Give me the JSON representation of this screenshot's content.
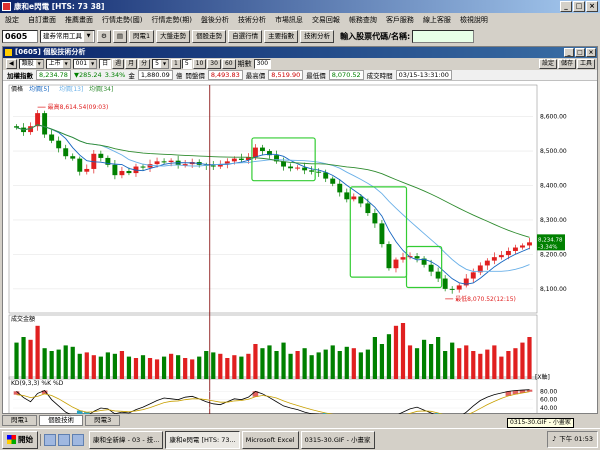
{
  "window": {
    "title": "康和e閃電 [HTS: 73 38]"
  },
  "menu": [
    "設定",
    "自訂畫面",
    "推薦畫面",
    "行情走勢(國)",
    "行情走勢(期)",
    "盤後分析",
    "技術分析",
    "市場訊息",
    "交易回報",
    "帳務查詢",
    "客戶服務",
    "線上客服",
    "檢視說明"
  ],
  "toolbar": {
    "code": "0605",
    "tool_select": "建券常用工具",
    "buttons": [
      "閃電1",
      "大盤走勢",
      "個股走勢",
      "自選行情",
      "主要指數",
      "技術分析"
    ],
    "stock_prompt": "輸入股票代碼/名稱:"
  },
  "child": {
    "title": "[0605] 個股技術分析",
    "win_buttons": [
      "_",
      "□",
      "×"
    ]
  },
  "controls": {
    "category": "類股",
    "market": "上市",
    "index_code": "001",
    "periods": [
      "日",
      "週",
      "月",
      "分"
    ],
    "minute": "5",
    "intervals": [
      "1",
      "5",
      "10",
      "30",
      "60"
    ],
    "active_interval": "5",
    "bars_label": "期數",
    "bars_value": "300",
    "right_buttons": [
      "設定",
      "儲存",
      "工具"
    ]
  },
  "quote": {
    "name": "加權指數",
    "price": "8,234.78",
    "change": "▼285.24",
    "pct": "3.34%",
    "vol_label": "金",
    "volume": "1,880.09",
    "vol_unit": "億",
    "open_label": "開盤價",
    "open": "8,493.83",
    "high_label": "最高價",
    "high": "8,519.90",
    "low_label": "最低價",
    "low": "8,070.52",
    "time_label": "成交時間",
    "time": "03/15-13:31:00"
  },
  "colors": {
    "up": "#e02020",
    "down": "#008000",
    "ma5": "#1565c0",
    "ma13": "#6ab0e8",
    "ma34": "#2e8b2e",
    "highlight_box": "#33cc33",
    "cursor": "#800000",
    "k": "#000000",
    "d": "#c8a000"
  },
  "chart_data": [
    {
      "type": "candlestick",
      "title": "價格",
      "legend": [
        "均價[5]",
        "均價[13]",
        "均價[34]"
      ],
      "ylim": [
        8030,
        8680
      ],
      "yticks": [
        8100,
        8200,
        8300,
        8400,
        8500,
        8600
      ],
      "ytick_labels": [
        "8,100.00",
        "8,200.00",
        "8,300.00",
        "8,400.00",
        "8,500.00",
        "8,600.00"
      ],
      "x_labels": [
        "12:50",
        "03/14",
        "10",
        "11",
        "12",
        "13",
        "03/15",
        "10",
        "11",
        "12",
        "13",
        "13:30"
      ],
      "annotations": [
        {
          "text": "最高8,614.54(09:03)",
          "index": 3
        },
        {
          "text": "最低8,070.52(12:15)",
          "index": 61
        }
      ],
      "last_price_labels": [
        "8,234.78",
        "-3.34%"
      ],
      "closes": [
        8568,
        8555,
        8572,
        8610,
        8548,
        8530,
        8508,
        8485,
        8478,
        8440,
        8448,
        8492,
        8480,
        8460,
        8430,
        8442,
        8436,
        8455,
        8452,
        8462,
        8470,
        8468,
        8472,
        8458,
        8462,
        8468,
        8460,
        8458,
        8455,
        8462,
        8470,
        8478,
        8474,
        8482,
        8510,
        8500,
        8488,
        8470,
        8455,
        8450,
        8452,
        8444,
        8440,
        8438,
        8420,
        8405,
        8380,
        8360,
        8368,
        8348,
        8320,
        8290,
        8230,
        8160,
        8185,
        8192,
        8195,
        8188,
        8170,
        8150,
        8130,
        8100,
        8098,
        8110,
        8130,
        8148,
        8168,
        8182,
        8192,
        8198,
        8210,
        8220,
        8226,
        8235
      ],
      "highlight_boxes": [
        [
          34,
          42
        ],
        [
          48,
          55
        ],
        [
          56,
          60
        ]
      ]
    },
    {
      "type": "bar",
      "title": "成交金額",
      "x_label_button": "[X軸]",
      "values": [
        26,
        30,
        28,
        38,
        22,
        20,
        21,
        24,
        23,
        18,
        19,
        17,
        16,
        19,
        18,
        20,
        16,
        15,
        17,
        15,
        14,
        16,
        18,
        17,
        15,
        14,
        16,
        20,
        19,
        18,
        15,
        17,
        16,
        18,
        25,
        22,
        24,
        20,
        26,
        18,
        20,
        22,
        17,
        19,
        21,
        24,
        20,
        23,
        22,
        19,
        21,
        30,
        25,
        32,
        38,
        40,
        24,
        22,
        28,
        25,
        30,
        20,
        26,
        22,
        24,
        20,
        18,
        21,
        24,
        16,
        20,
        22,
        26,
        30
      ]
    },
    {
      "type": "line",
      "title": "KD(9,3,3) %K %D",
      "yticks": [
        -20,
        20,
        40,
        60,
        80
      ],
      "ytick_labels": [
        "-20.00",
        "20.00",
        "40.00",
        "60.00",
        "80.00"
      ],
      "k": [
        80,
        65,
        55,
        75,
        82,
        60,
        45,
        30,
        22,
        18,
        20,
        32,
        40,
        38,
        26,
        30,
        28,
        36,
        42,
        50,
        58,
        64,
        62,
        60,
        66,
        68,
        62,
        55,
        50,
        48,
        55,
        62,
        60,
        66,
        80,
        74,
        65,
        55,
        45,
        40,
        36,
        30,
        26,
        25,
        20,
        18,
        15,
        14,
        18,
        22,
        18,
        15,
        12,
        10,
        22,
        30,
        38,
        42,
        35,
        28,
        20,
        12,
        10,
        18,
        30,
        45,
        58,
        66,
        72,
        76,
        80,
        82,
        83,
        84
      ],
      "d": [
        72,
        70,
        65,
        68,
        74,
        70,
        62,
        52,
        42,
        34,
        30,
        31,
        34,
        36,
        33,
        32,
        31,
        33,
        36,
        41,
        47,
        53,
        56,
        57,
        60,
        62,
        62,
        60,
        57,
        54,
        54,
        57,
        58,
        61,
        67,
        70,
        68,
        64,
        57,
        51,
        46,
        41,
        36,
        32,
        28,
        25,
        22,
        19,
        18,
        19,
        19,
        18,
        16,
        14,
        17,
        21,
        27,
        32,
        33,
        32,
        28,
        23,
        18,
        18,
        22,
        30,
        39,
        48,
        56,
        63,
        69,
        73,
        76,
        79
      ]
    }
  ],
  "tabs": [
    "閃電1",
    "個股技術",
    "閃電3"
  ],
  "taskbar": {
    "start": "開始",
    "tasks": [
      "康和全新緯 - 03 - 技...",
      "康和e閃電 [HTS: 73...",
      "Microsoft Excel",
      "0315-30.GIF - 小畫家"
    ],
    "time": "下午 01:53",
    "tooltip": "0315-30.GIF - 小畫家"
  }
}
